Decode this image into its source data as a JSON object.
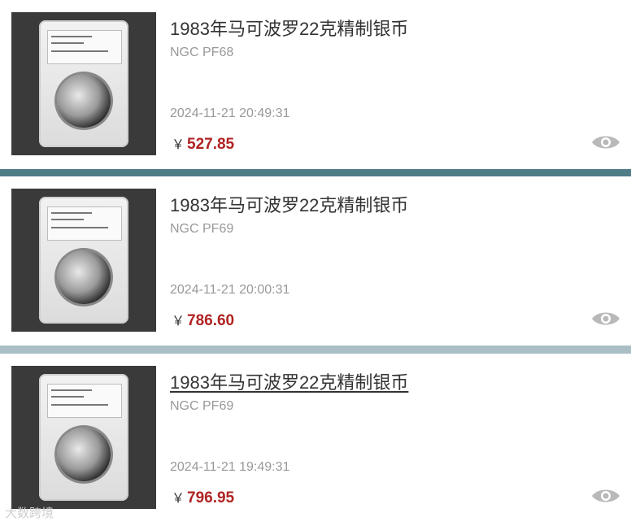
{
  "items": [
    {
      "title": "1983年马可波罗22克精制银币",
      "grade": "NGC PF68",
      "time": "2024-11-21 20:49:31",
      "currency": "￥",
      "price": "527.85"
    },
    {
      "title": "1983年马可波罗22克精制银币",
      "grade": "NGC PF69",
      "time": "2024-11-21 20:00:31",
      "currency": "￥",
      "price": "786.60"
    },
    {
      "title": "1983年马可波罗22克精制银币",
      "grade": "NGC PF69",
      "time": "2024-11-21 19:49:31",
      "currency": "￥",
      "price": "796.95"
    }
  ],
  "watermark": "大数跨境",
  "icons": {
    "view": "eye-icon"
  },
  "colors": {
    "price": "#b02323",
    "separator_1": "#4e7d87",
    "separator_2": "#a9bfc5",
    "muted_text": "#999999"
  }
}
